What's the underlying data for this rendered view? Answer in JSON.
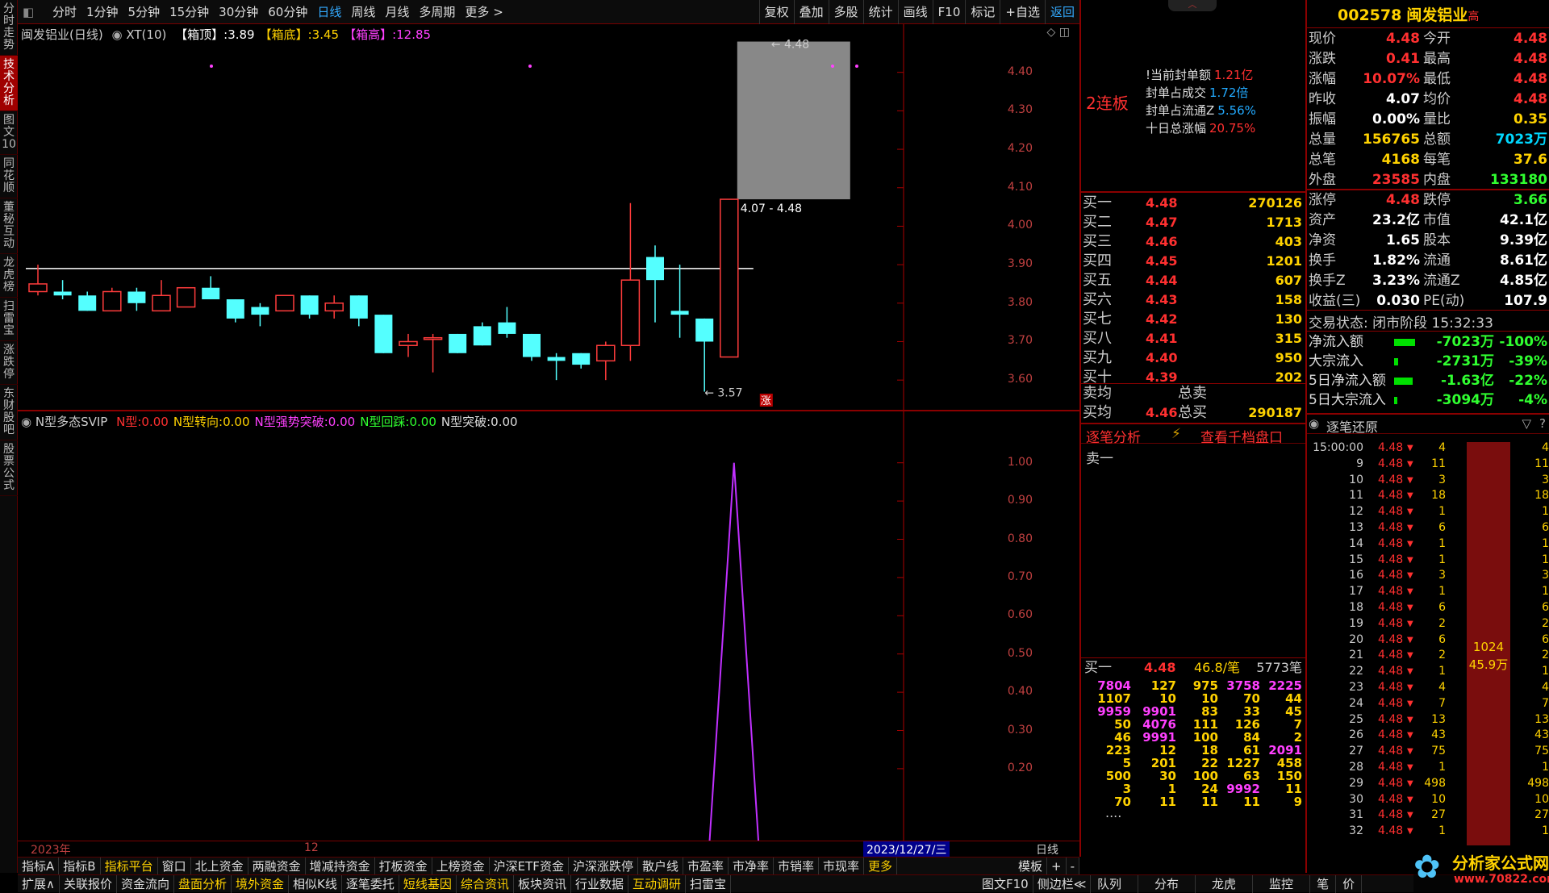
{
  "left_tabs": [
    "分时走势",
    "技术分析",
    "图文10",
    "同花顺",
    "董秘互动",
    "龙虎榜",
    "扫雷宝",
    "涨跌停",
    "东财股吧",
    "股票公式"
  ],
  "left_active_index": 1,
  "toolbar": {
    "periods": [
      "分时",
      "1分钟",
      "5分钟",
      "15分钟",
      "30分钟",
      "60分钟",
      "日线",
      "周线",
      "月线",
      "多周期",
      "更多 >"
    ],
    "selected": "日线",
    "tools": [
      "复权",
      "叠加",
      "多股",
      "统计",
      "画线",
      "F10",
      "标记",
      "+自选",
      "返回"
    ]
  },
  "main_chart": {
    "title": "闽发铝业(日线)",
    "indicator": "XT(10)",
    "legend": [
      {
        "label": "【箱顶】:",
        "value": "3.89",
        "color": "#ffffff"
      },
      {
        "label": "【箱底】:",
        "value": "3.45",
        "color": "#ffd200"
      },
      {
        "label": "【箱高】:",
        "value": "12.85",
        "color": "#ff40ff"
      }
    ],
    "y_ticks": [
      "4.40",
      "4.30",
      "4.20",
      "4.10",
      "4.00",
      "3.90",
      "3.80",
      "3.70",
      "3.60"
    ],
    "box_range_label": "4.07 - 4.48",
    "max_label": "4.48",
    "min_label": "3.57",
    "zt_badge": "涨",
    "resistance_price": 3.89
  },
  "chart_data": [
    {
      "type": "candlestick",
      "title": "闽发铝业(日线)",
      "ylim": [
        3.55,
        4.5
      ],
      "candles": [
        {
          "o": 3.83,
          "c": 3.85,
          "h": 3.9,
          "l": 3.82
        },
        {
          "o": 3.83,
          "c": 3.82,
          "h": 3.86,
          "l": 3.81
        },
        {
          "o": 3.82,
          "c": 3.78,
          "h": 3.83,
          "l": 3.78
        },
        {
          "o": 3.78,
          "c": 3.83,
          "h": 3.84,
          "l": 3.78
        },
        {
          "o": 3.83,
          "c": 3.8,
          "h": 3.84,
          "l": 3.78
        },
        {
          "o": 3.78,
          "c": 3.82,
          "h": 3.86,
          "l": 3.78
        },
        {
          "o": 3.79,
          "c": 3.84,
          "h": 3.84,
          "l": 3.79
        },
        {
          "o": 3.84,
          "c": 3.81,
          "h": 3.87,
          "l": 3.81
        },
        {
          "o": 3.81,
          "c": 3.76,
          "h": 3.81,
          "l": 3.75
        },
        {
          "o": 3.79,
          "c": 3.77,
          "h": 3.8,
          "l": 3.74
        },
        {
          "o": 3.78,
          "c": 3.82,
          "h": 3.82,
          "l": 3.78
        },
        {
          "o": 3.82,
          "c": 3.77,
          "h": 3.82,
          "l": 3.76
        },
        {
          "o": 3.78,
          "c": 3.8,
          "h": 3.82,
          "l": 3.76
        },
        {
          "o": 3.82,
          "c": 3.76,
          "h": 3.82,
          "l": 3.74
        },
        {
          "o": 3.77,
          "c": 3.67,
          "h": 3.77,
          "l": 3.67
        },
        {
          "o": 3.69,
          "c": 3.7,
          "h": 3.72,
          "l": 3.66
        },
        {
          "o": 3.71,
          "c": 3.71,
          "h": 3.72,
          "l": 3.62
        },
        {
          "o": 3.72,
          "c": 3.67,
          "h": 3.72,
          "l": 3.67
        },
        {
          "o": 3.74,
          "c": 3.69,
          "h": 3.75,
          "l": 3.69
        },
        {
          "o": 3.75,
          "c": 3.72,
          "h": 3.79,
          "l": 3.71
        },
        {
          "o": 3.72,
          "c": 3.66,
          "h": 3.72,
          "l": 3.65
        },
        {
          "o": 3.66,
          "c": 3.65,
          "h": 3.67,
          "l": 3.6
        },
        {
          "o": 3.67,
          "c": 3.64,
          "h": 3.67,
          "l": 3.63
        },
        {
          "o": 3.65,
          "c": 3.69,
          "h": 3.7,
          "l": 3.6
        },
        {
          "o": 3.69,
          "c": 3.86,
          "h": 4.06,
          "l": 3.65
        },
        {
          "o": 3.92,
          "c": 3.86,
          "h": 3.95,
          "l": 3.75
        },
        {
          "o": 3.78,
          "c": 3.77,
          "h": 3.9,
          "l": 3.71
        },
        {
          "o": 3.76,
          "c": 3.7,
          "h": 3.76,
          "l": 3.57
        },
        {
          "o": 3.66,
          "c": 4.07,
          "h": 4.07,
          "l": 3.66
        }
      ]
    },
    {
      "type": "line",
      "title": "N型多态SVIP",
      "ylim": [
        0.05,
        1.05
      ],
      "y_ticks": [
        "1.00",
        "0.90",
        "0.80",
        "0.70",
        "0.60",
        "0.50",
        "0.40",
        "0.30",
        "0.20"
      ],
      "values": [
        0,
        0,
        0,
        0,
        0,
        0,
        0,
        0,
        0,
        0,
        0,
        0,
        0,
        0,
        0,
        0,
        0,
        0,
        0,
        0,
        0,
        0,
        0,
        0,
        0,
        0,
        0,
        0,
        1,
        0
      ]
    }
  ],
  "sub_chart": {
    "title": "N型多态SVIP",
    "legend": [
      {
        "label": "N型:",
        "value": "0.00",
        "color": "#ff3030"
      },
      {
        "label": "N型转向:",
        "value": "0.00",
        "color": "#ffd200"
      },
      {
        "label": "N型强势突破:",
        "value": "0.00",
        "color": "#ff40ff"
      },
      {
        "label": "N型回踩:",
        "value": "0.00",
        "color": "#30ff30"
      },
      {
        "label": "N型突破:",
        "value": "0.00",
        "color": "#dddddd"
      }
    ],
    "x_labels": [
      "2023年",
      "12"
    ],
    "date_badge": "2023/12/27/三",
    "period_label": "日线"
  },
  "mid_panel": {
    "streak": "2连板",
    "seal": [
      {
        "label": "!当前封单额",
        "value": "1.21亿"
      },
      {
        "label": "封单占成交",
        "value": "1.72倍"
      },
      {
        "label": "封单占流通Z",
        "value": "5.56%"
      },
      {
        "label": "十日总涨幅",
        "value": "20.75%"
      }
    ],
    "bids": [
      {
        "name": "买一",
        "price": "4.48",
        "vol": "270126"
      },
      {
        "name": "买二",
        "price": "4.47",
        "vol": "1713"
      },
      {
        "name": "买三",
        "price": "4.46",
        "vol": "403"
      },
      {
        "name": "买四",
        "price": "4.45",
        "vol": "1201"
      },
      {
        "name": "买五",
        "price": "4.44",
        "vol": "607"
      },
      {
        "name": "买六",
        "price": "4.43",
        "vol": "158"
      },
      {
        "name": "买七",
        "price": "4.42",
        "vol": "130"
      },
      {
        "name": "买八",
        "price": "4.41",
        "vol": "315"
      },
      {
        "name": "买九",
        "price": "4.40",
        "vol": "950"
      },
      {
        "name": "买十",
        "price": "4.39",
        "vol": "202"
      }
    ],
    "avg_rows": [
      {
        "name": "卖均",
        "mid": "总卖",
        "price": "",
        "vol": ""
      },
      {
        "name": "买均",
        "mid": "总买",
        "price": "4.46",
        "vol": "290187"
      }
    ],
    "tabs": [
      "逐笔分析",
      "查看千档盘口"
    ],
    "sell_label": "卖一",
    "buy_summary": {
      "name": "买一",
      "price": "4.48",
      "avg": "46.8/笔",
      "count": "5773笔"
    },
    "queue": [
      [
        "7804",
        "127",
        "975",
        "3758",
        "2225"
      ],
      [
        "1107",
        "10",
        "10",
        "70",
        "44"
      ],
      [
        "9959",
        "9901",
        "83",
        "33",
        "45"
      ],
      [
        "50",
        "4076",
        "111",
        "126",
        "7"
      ],
      [
        "46",
        "9991",
        "100",
        "84",
        "2"
      ],
      [
        "223",
        "12",
        "18",
        "61",
        "2091"
      ],
      [
        "5",
        "201",
        "22",
        "1227",
        "458"
      ],
      [
        "500",
        "30",
        "100",
        "63",
        "150"
      ],
      [
        "3",
        "1",
        "24",
        "9992",
        "11"
      ],
      [
        "70",
        "11",
        "11",
        "11",
        "9"
      ]
    ],
    "queue_more": "...."
  },
  "right_panel": {
    "code": "002578",
    "name": "闽发铝业",
    "tag": "高",
    "stats": [
      [
        "现价",
        "4.48",
        "今开",
        "4.48"
      ],
      [
        "涨跌",
        "0.41",
        "最高",
        "4.48"
      ],
      [
        "涨幅",
        "10.07%",
        "最低",
        "4.48"
      ],
      [
        "昨收",
        "4.07",
        "均价",
        "4.48"
      ],
      [
        "振幅",
        "0.00%",
        "量比",
        "0.35"
      ],
      [
        "总量",
        "156765",
        "总额",
        "7023万"
      ],
      [
        "总笔",
        "4168",
        "每笔",
        "37.6"
      ],
      [
        "外盘",
        "23585",
        "内盘",
        "133180"
      ]
    ],
    "stats2": [
      [
        "涨停",
        "4.48",
        "跌停",
        "3.66"
      ],
      [
        "资产",
        "23.2亿",
        "市值",
        "42.1亿"
      ],
      [
        "净资",
        "1.65",
        "股本",
        "9.39亿"
      ],
      [
        "换手",
        "1.82%",
        "流通",
        "8.61亿"
      ],
      [
        "换手Z",
        "3.23%",
        "流通Z",
        "4.85亿"
      ],
      [
        "收益(三)",
        "0.030",
        "PE(动)",
        "107.9"
      ]
    ],
    "trade_status": "交易状态: 闭市阶段 15:32:33",
    "flows": [
      {
        "label": "净流入额",
        "value": "-7023万",
        "pct": "-100%",
        "bar": 1.0
      },
      {
        "label": "大宗流入",
        "value": "-2731万",
        "pct": "-39%",
        "bar": 0.2
      },
      {
        "label": "5日净流入额",
        "value": "-1.63亿",
        "pct": "-22%",
        "bar": 0.9
      },
      {
        "label": "5日大宗流入",
        "value": "-3094万",
        "pct": "-4%",
        "bar": 0.15
      }
    ],
    "ticks_title": "逐笔还原",
    "ticks": [
      [
        "15:00:00",
        "4.48",
        "4",
        "4"
      ],
      [
        "9",
        "4.48",
        "11",
        "11"
      ],
      [
        "10",
        "4.48",
        "3",
        "3"
      ],
      [
        "11",
        "4.48",
        "18",
        "18"
      ],
      [
        "12",
        "4.48",
        "1",
        "1"
      ],
      [
        "13",
        "4.48",
        "6",
        "6"
      ],
      [
        "14",
        "4.48",
        "1",
        "1"
      ],
      [
        "15",
        "4.48",
        "1",
        "1"
      ],
      [
        "16",
        "4.48",
        "3",
        "3"
      ],
      [
        "17",
        "4.48",
        "1",
        "1"
      ],
      [
        "18",
        "4.48",
        "6",
        "6"
      ],
      [
        "19",
        "4.48",
        "2",
        "2"
      ],
      [
        "20",
        "4.48",
        "6",
        "6"
      ],
      [
        "21",
        "4.48",
        "2",
        "2"
      ],
      [
        "22",
        "4.48",
        "1",
        "1"
      ],
      [
        "23",
        "4.48",
        "4",
        "4"
      ],
      [
        "24",
        "4.48",
        "7",
        "7"
      ],
      [
        "25",
        "4.48",
        "13",
        "13"
      ],
      [
        "26",
        "4.48",
        "43",
        "43"
      ],
      [
        "27",
        "4.48",
        "75",
        "75"
      ],
      [
        "28",
        "4.48",
        "1",
        "1"
      ],
      [
        "29",
        "4.48",
        "498",
        "498"
      ],
      [
        "30",
        "4.48",
        "10",
        "10"
      ],
      [
        "31",
        "4.48",
        "27",
        "27"
      ],
      [
        "32",
        "4.48",
        "1",
        "1"
      ]
    ],
    "big_order": {
      "count": "1024",
      "amount": "45.9万"
    }
  },
  "bottom_bar1": [
    "指标A",
    "指标B",
    "指标平台",
    "窗口",
    "北上资金",
    "两融资金",
    "增减持资金",
    "打板资金",
    "上榜资金",
    "沪深ETF资金",
    "沪深涨跌停",
    "散户线",
    "市盈率",
    "市净率",
    "市销率",
    "市现率",
    "更多"
  ],
  "bottom_bar1_right": [
    "模板",
    "+",
    "-"
  ],
  "bottom_bar2": [
    "扩展∧",
    "关联报价",
    "资金流向",
    "盘面分析",
    "境外资金",
    "相似K线",
    "逐笔委托",
    "短线基因",
    "综合资讯",
    "板块资讯",
    "行业数据",
    "互动调研",
    "扫雷宝"
  ],
  "bottom_bar2_right": [
    "图文F10",
    "侧边栏≪"
  ],
  "bottom_bar3": [
    "队列",
    "分布",
    "龙虎",
    "监控",
    "笔",
    "价"
  ],
  "watermark": {
    "name": "分析家公式网",
    "url": "www.70822.com"
  }
}
